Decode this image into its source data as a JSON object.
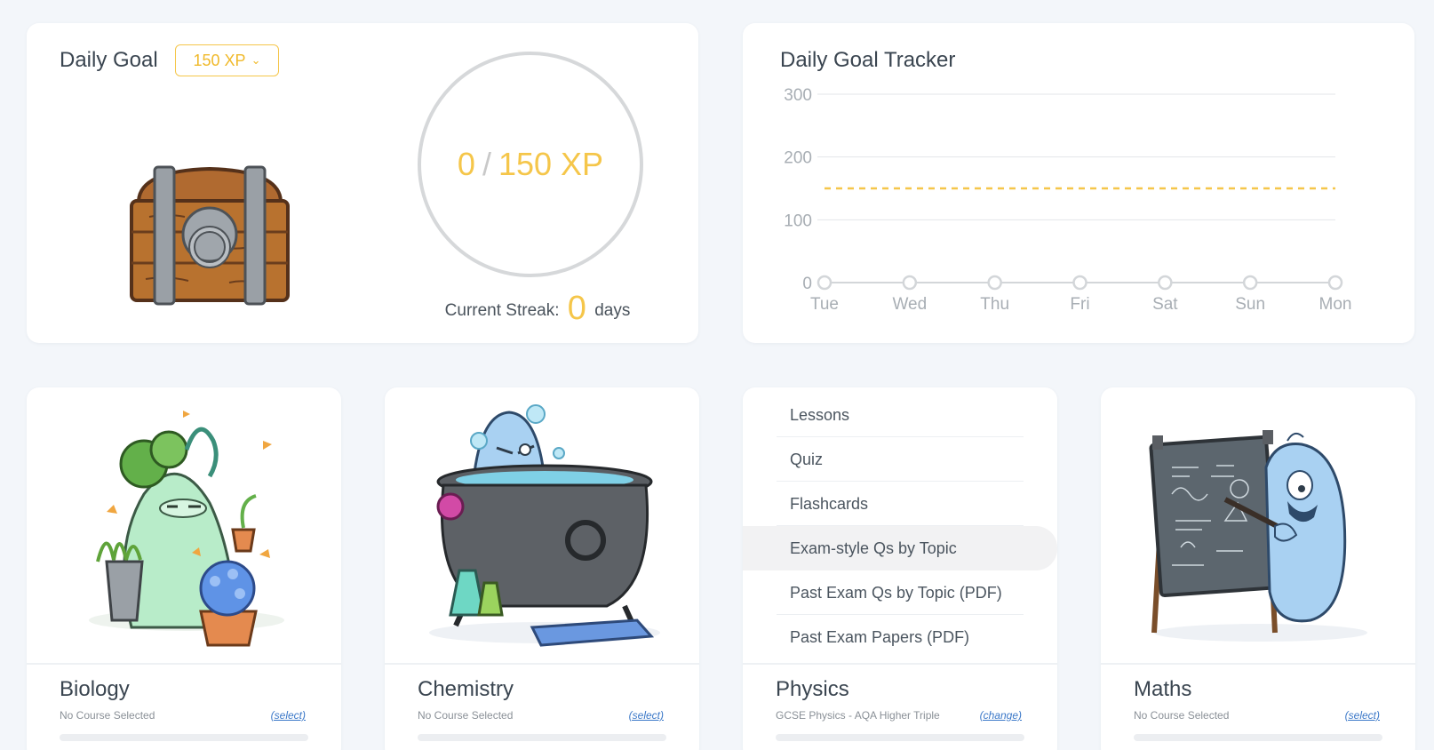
{
  "daily_goal": {
    "title": "Daily Goal",
    "selected_goal": "150 XP",
    "progress_current": "0",
    "progress_target": "150 XP",
    "streak_label": "Current Streak:",
    "streak_value": "0",
    "streak_unit": "days"
  },
  "tracker": {
    "title": "Daily Goal Tracker",
    "chart_data": {
      "type": "line",
      "x": [
        "Tue",
        "Wed",
        "Thu",
        "Fri",
        "Sat",
        "Sun",
        "Mon"
      ],
      "series": [
        {
          "values": [
            0,
            0,
            0,
            0,
            0,
            0,
            0
          ]
        }
      ],
      "goal_line": 150,
      "yticks": [
        0,
        100,
        200,
        300
      ],
      "ylim": [
        0,
        300
      ],
      "grid": true,
      "goal_color": "#f5c64a",
      "line_color": "#d3d6d9"
    }
  },
  "subjects": {
    "biology": {
      "name": "Biology",
      "course": "No Course Selected",
      "link": "(select)"
    },
    "chemistry": {
      "name": "Chemistry",
      "course": "No Course Selected",
      "link": "(select)"
    },
    "physics": {
      "name": "Physics",
      "course": "GCSE Physics - AQA Higher Triple",
      "link": "(change)",
      "menu": [
        "Lessons",
        "Quiz",
        "Flashcards",
        "Exam-style Qs by Topic",
        "Past Exam Qs by Topic (PDF)",
        "Past Exam Papers (PDF)"
      ],
      "active_menu": "Exam-style Qs by Topic"
    },
    "maths": {
      "name": "Maths",
      "course": "No Course Selected",
      "link": "(select)"
    }
  },
  "colors": {
    "accent": "#f5c64a",
    "link": "#3b78c8"
  }
}
